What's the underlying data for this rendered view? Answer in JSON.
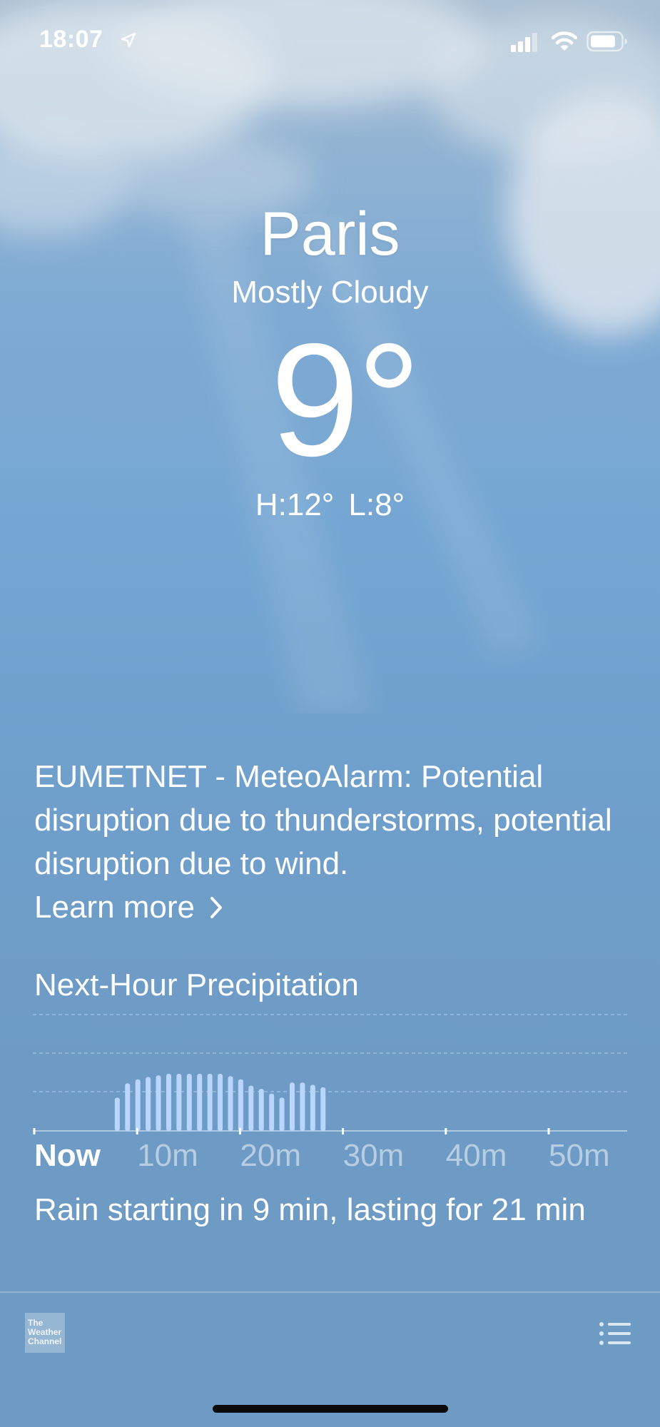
{
  "status_bar": {
    "time": "18:07"
  },
  "weather": {
    "city": "Paris",
    "condition": "Mostly Cloudy",
    "temperature": "9°",
    "high": "H:12°",
    "low": "L:8°"
  },
  "alert": {
    "text": "EUMETNET - MeteoAlarm: Potential disruption due to thunderstorms, potential disruption due to wind.",
    "learn_more": "Learn more"
  },
  "precipitation": {
    "title": "Next-Hour Precipitation",
    "summary": "Rain starting in 9 min, lasting for 21 min",
    "tick_labels": [
      "Now",
      "10m",
      "20m",
      "30m",
      "40m",
      "50m"
    ]
  },
  "chart_data": {
    "type": "bar",
    "x_unit": "minutes from now",
    "x": [
      8,
      9,
      10,
      11,
      12,
      13,
      14,
      15,
      16,
      17,
      18,
      19,
      20,
      21,
      22,
      23,
      24,
      25,
      26,
      27,
      28
    ],
    "values": [
      0.42,
      0.6,
      0.65,
      0.68,
      0.7,
      0.72,
      0.72,
      0.72,
      0.72,
      0.72,
      0.72,
      0.69,
      0.65,
      0.57,
      0.53,
      0.47,
      0.42,
      0.61,
      0.61,
      0.58,
      0.55
    ],
    "xlim": [
      0,
      60
    ],
    "ylim": [
      0,
      1
    ],
    "x_ticks": [
      "Now",
      "10m",
      "20m",
      "30m",
      "40m",
      "50m"
    ],
    "grid": true,
    "bar_color": "#b9d6ff"
  },
  "footer": {
    "logo_lines": [
      "The",
      "Weather",
      "Channel"
    ]
  },
  "colors": {
    "background": "#74a6d3",
    "text": "#ffffff",
    "bar": "#b9d6ff"
  },
  "icons": {
    "location": "location-arrow-icon",
    "signal": "cellular-signal-icon",
    "wifi": "wifi-icon",
    "battery": "battery-icon",
    "chevron": "chevron-right-icon",
    "list": "list-icon"
  }
}
